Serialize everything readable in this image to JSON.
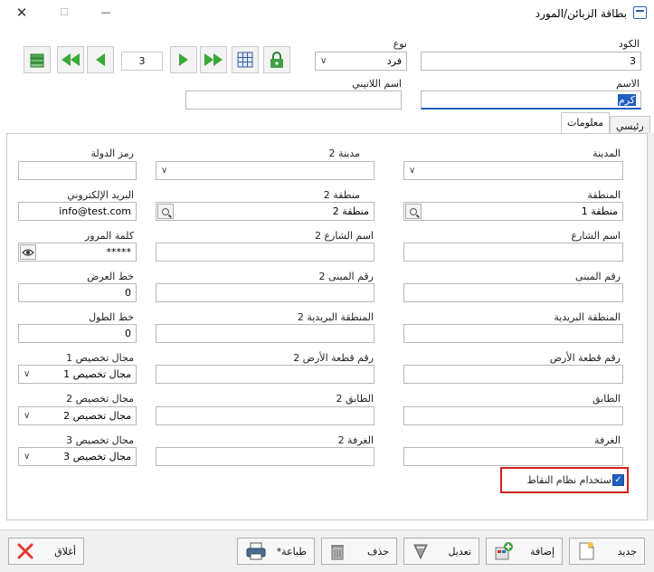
{
  "window": {
    "title": "بطاقة الزبائن/المورد",
    "close_glyph": "✕",
    "max_glyph": "☐",
    "min_glyph": "—"
  },
  "header": {
    "code_label": "الكود",
    "code_value": "3",
    "type_label": "نوع",
    "type_value": "فرد",
    "name_label": "الاسم",
    "name_value": "كرم",
    "latin_name_label": "اسم اللاتيني",
    "latin_name_value": "",
    "page_number": "3"
  },
  "tabs": [
    {
      "label": "رئيسي",
      "active": false
    },
    {
      "label": "معلومات",
      "active": true
    }
  ],
  "form": {
    "city_label": "المدينة",
    "city_value": "",
    "city2_label": "مدينة 2",
    "city2_value": "",
    "country_code_label": "رمز الدولة",
    "country_code_value": "",
    "region_label": "المنطقة",
    "region_value": "منطقة 1",
    "region2_label": "منطقة 2",
    "region2_value": "منطقة 2",
    "email_label": "البريد الإلكتروني",
    "email_value": "info@test.com",
    "street_label": "اسم الشارع",
    "street_value": "",
    "street2_label": "اسم الشارع 2",
    "street2_value": "",
    "password_label": "كلمة المرور",
    "password_value": "*****",
    "building_label": "رقم المبنى",
    "building_value": "",
    "building2_label": "رقم المبنى 2",
    "building2_value": "",
    "latitude_label": "خط العرض",
    "latitude_value": "0",
    "postal_label": "المنطقة البريدية",
    "postal_value": "",
    "postal2_label": "المنطقة البريدية 2",
    "postal2_value": "",
    "longitude_label": "خط الطول",
    "longitude_value": "0",
    "plot_label": "رقم قطعة الأرض",
    "plot_value": "",
    "plot2_label": "رقم قطعة الأرض 2",
    "plot2_value": "",
    "spec1_label": "مجال تخصيص 1",
    "spec1_value": "مجال تخصيص 1",
    "floor_label": "الطابق",
    "floor_value": "",
    "floor2_label": "الطابق 2",
    "floor2_value": "",
    "spec2_label": "مجال تخصيص 2",
    "spec2_value": "مجال تخصيص 2",
    "room_label": "الغرفة",
    "room_value": "",
    "room2_label": "الغرفة 2",
    "room2_value": "",
    "spec3_label": "مجال تخصيص 3",
    "spec3_value": "مجال تخصيص 3",
    "points_label": "استخدام نظام النقاط",
    "points_checked": true
  },
  "bottom": {
    "new_label": "جديد",
    "add_label": "إضافة",
    "edit_label": "تعديل",
    "delete_label": "حذف",
    "print_label": "طباعة*",
    "close_label": "أغلاق"
  },
  "colors": {
    "accent_blue": "#1f5fbf",
    "highlight_red": "#d42020",
    "nav_green": "#3aa83a"
  }
}
